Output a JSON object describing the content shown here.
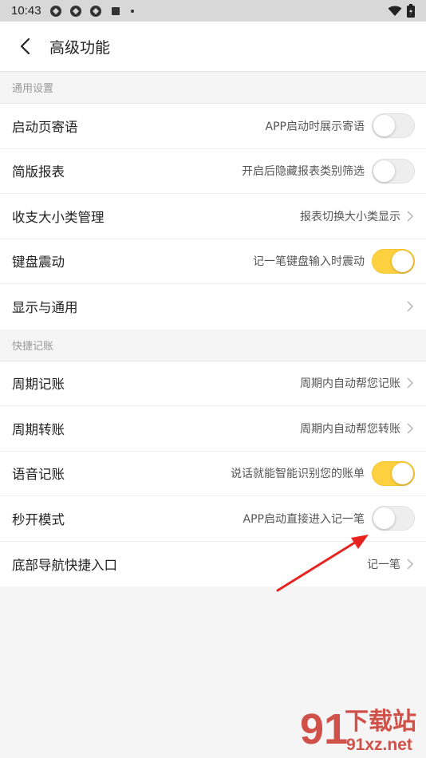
{
  "status_bar": {
    "time": "10:43"
  },
  "header": {
    "title": "高级功能"
  },
  "sections": [
    {
      "title": "通用设置",
      "items": [
        {
          "label": "启动页寄语",
          "desc": "APP启动时展示寄语",
          "control": "toggle",
          "on": false
        },
        {
          "label": "简版报表",
          "desc": "开启后隐藏报表类别筛选",
          "control": "toggle",
          "on": false
        },
        {
          "label": "收支大小类管理",
          "desc": "报表切换大小类显示",
          "control": "chevron"
        },
        {
          "label": "键盘震动",
          "desc": "记一笔键盘输入时震动",
          "control": "toggle",
          "on": true
        },
        {
          "label": "显示与通用",
          "desc": "",
          "control": "chevron"
        }
      ]
    },
    {
      "title": "快捷记账",
      "items": [
        {
          "label": "周期记账",
          "desc": "周期内自动帮您记账",
          "control": "chevron"
        },
        {
          "label": "周期转账",
          "desc": "周期内自动帮您转账",
          "control": "chevron"
        },
        {
          "label": "语音记账",
          "desc": "说话就能智能识别您的账单",
          "control": "toggle",
          "on": true
        },
        {
          "label": "秒开模式",
          "desc": "APP启动直接进入记一笔",
          "control": "toggle",
          "on": false
        },
        {
          "label": "底部导航快捷入口",
          "desc": "记一笔",
          "control": "chevron"
        }
      ]
    }
  ],
  "watermark": {
    "brand": "下载站",
    "domain": "91xz.net",
    "number": "91"
  },
  "colors": {
    "toggle_on": "#ffd040",
    "annotation_arrow": "#e8231f",
    "watermark": "#c9342c"
  }
}
